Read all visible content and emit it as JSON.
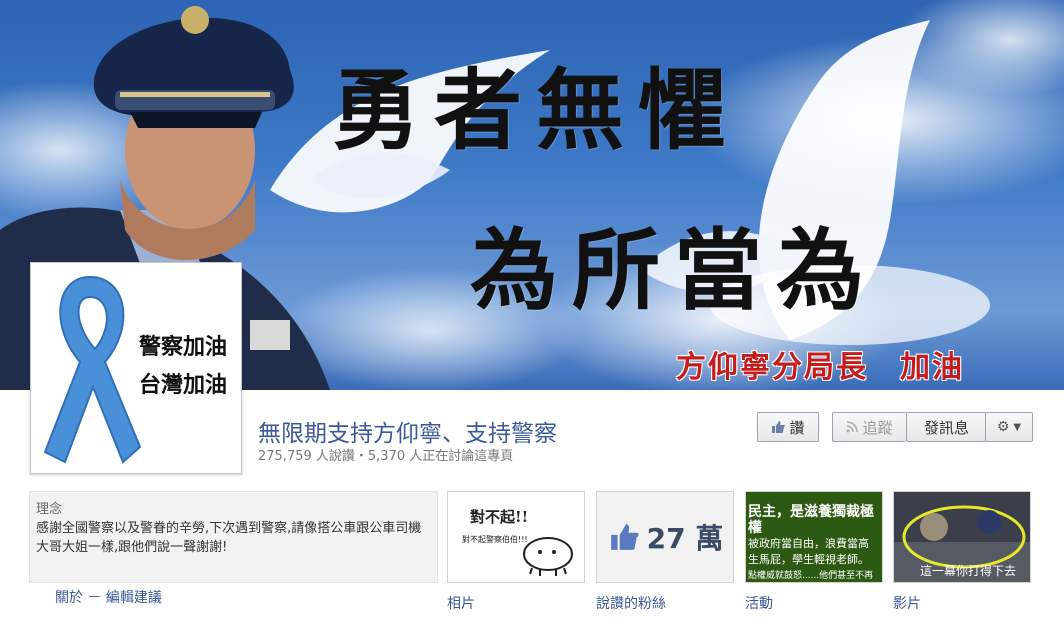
{
  "cover": {
    "line1": "勇者無懼",
    "line2": "為所當為",
    "signature": "方仰寧分局長　加油"
  },
  "profile": {
    "line1": "警察加油",
    "line2": "台灣加油"
  },
  "page": {
    "title": "無限期支持方仰寧、支持警察",
    "stats": "275,759 人說讚・5,370 人正在討論這專頁"
  },
  "actions": {
    "like": "讚",
    "follow": "追蹤",
    "message": "發訊息"
  },
  "about": {
    "heading": "理念",
    "text": "感謝全國警察以及警眷的辛勞,下次遇到警察,請像搭公車跟公車司機大哥大姐一樣,跟他們說一聲謝謝!",
    "links": "關於 － 編輯建議"
  },
  "tiles": {
    "photos": {
      "label": "相片",
      "caption": "對不起!!",
      "subcaption": "對不起警察伯伯!!!"
    },
    "likes": {
      "label": "說讚的粉絲",
      "count": "27 萬"
    },
    "events": {
      "label": "活動",
      "line1": "民主，是滋養獨裁極權",
      "line2": "被政府當自由，浪費當高",
      "line3": "生馬屁，學生輕視老師。",
      "line4": "點權威就鼓怒......他們甚至不再"
    },
    "videos": {
      "label": "影片",
      "caption": "這一幕你打得下去"
    }
  },
  "colors": {
    "link": "#3b5998",
    "sky": "#2d64b3",
    "ribbon": "#4a90d9",
    "signature": "#c61b1b"
  }
}
